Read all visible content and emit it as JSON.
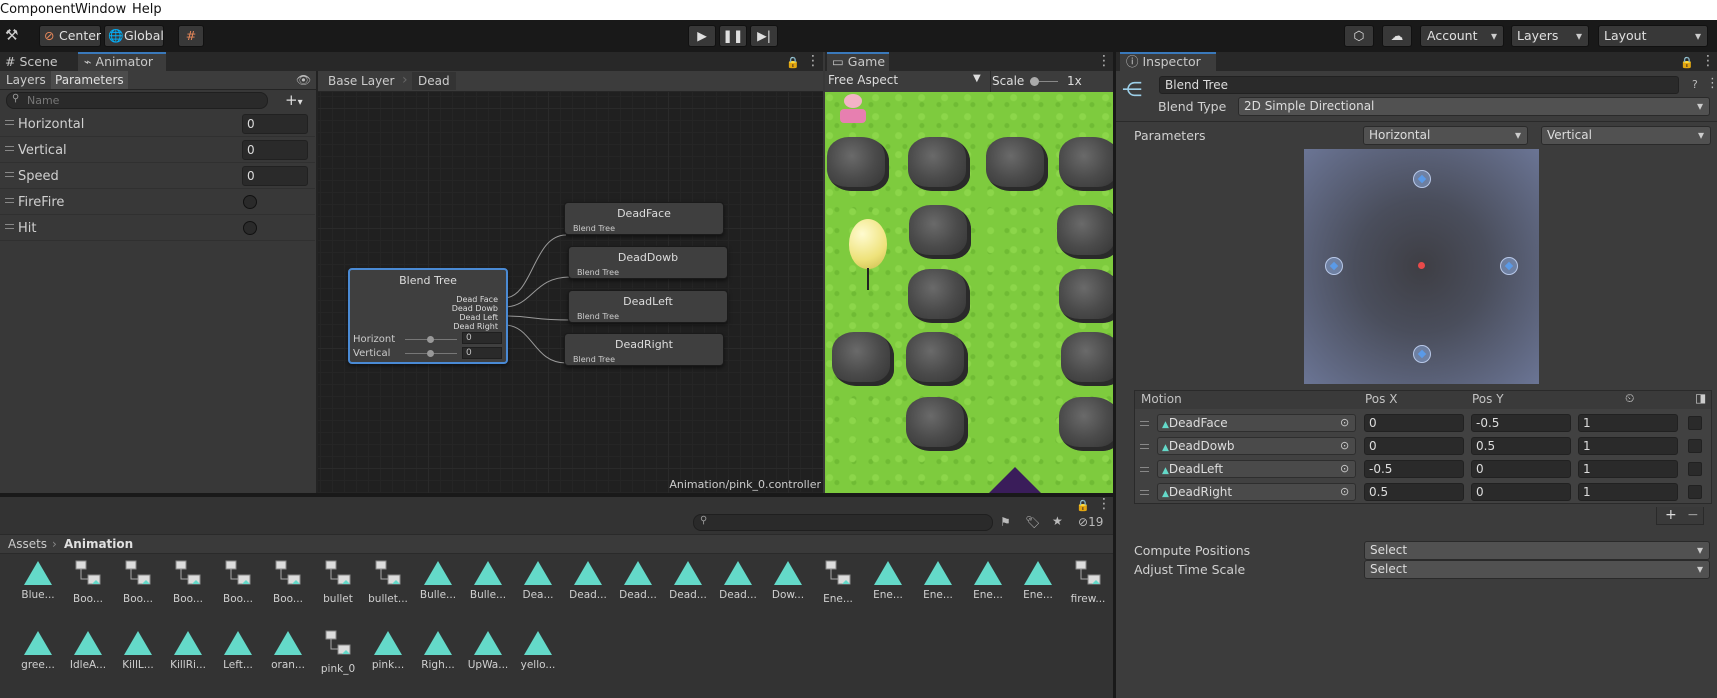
{
  "menubar": {
    "items": [
      "Component",
      "Window",
      "Help"
    ]
  },
  "toolbar": {
    "center_label": "Center",
    "global_label": "Global",
    "account_label": "Account",
    "layers_label": "Layers",
    "layout_label": "Layout"
  },
  "left_panel": {
    "tabs": [
      "Scene",
      "Animator"
    ],
    "subtabs": [
      "Layers",
      "Parameters"
    ],
    "search_placeholder": "Name",
    "parameters": [
      {
        "name": "Horizontal",
        "type": "float",
        "value": "0"
      },
      {
        "name": "Vertical",
        "type": "float",
        "value": "0"
      },
      {
        "name": "Speed",
        "type": "float",
        "value": "0"
      },
      {
        "name": "FireFire",
        "type": "trigger",
        "value": ""
      },
      {
        "name": "Hit",
        "type": "trigger",
        "value": ""
      }
    ]
  },
  "graph": {
    "breadcrumb": [
      "Base Layer",
      "Dead"
    ],
    "footer_path": "Animation/pink_0.controller",
    "blend_node": {
      "title": "Blend Tree",
      "outputs": [
        "Dead Face",
        "Dead Dowb",
        "Dead Left",
        "Dead Right"
      ],
      "params": [
        {
          "name": "Horizont",
          "value": "0"
        },
        {
          "name": "Vertical",
          "value": "0"
        }
      ]
    },
    "clips": [
      {
        "title": "DeadFace",
        "sub": "Blend Tree"
      },
      {
        "title": "DeadDowb",
        "sub": "Blend Tree"
      },
      {
        "title": "DeadLeft",
        "sub": "Blend Tree"
      },
      {
        "title": "DeadRight",
        "sub": "Blend Tree"
      }
    ]
  },
  "game": {
    "tab": "Game",
    "aspect": "Free Aspect",
    "scale_label": "Scale",
    "scale_value": "1x"
  },
  "inspector": {
    "tab": "Inspector",
    "name": "Blend Tree",
    "blend_type_label": "Blend Type",
    "blend_type": "2D Simple Directional",
    "parameters_label": "Parameters",
    "param_x": "Horizontal",
    "param_y": "Vertical",
    "motion_headers": [
      "Motion",
      "Pos X",
      "Pos Y"
    ],
    "motions": [
      {
        "name": "DeadFace",
        "x": "0",
        "y": "-0.5",
        "speed": "1"
      },
      {
        "name": "DeadDowb",
        "x": "0",
        "y": "0.5",
        "speed": "1"
      },
      {
        "name": "DeadLeft",
        "x": "-0.5",
        "y": "0",
        "speed": "1"
      },
      {
        "name": "DeadRight",
        "x": "0.5",
        "y": "0",
        "speed": "1"
      }
    ],
    "compute_label": "Compute Positions",
    "compute_value": "Select",
    "adjust_label": "Adjust Time Scale",
    "adjust_value": "Select"
  },
  "project": {
    "breadcrumb": [
      "Assets",
      "Animation"
    ],
    "hidden_count": "19",
    "assets": [
      {
        "label": "Blue...",
        "icon": "clip"
      },
      {
        "label": "Boo...",
        "icon": "tree"
      },
      {
        "label": "Boo...",
        "icon": "tree"
      },
      {
        "label": "Boo...",
        "icon": "tree"
      },
      {
        "label": "Boo...",
        "icon": "tree"
      },
      {
        "label": "Boo...",
        "icon": "tree"
      },
      {
        "label": "bullet",
        "icon": "tree"
      },
      {
        "label": "bullet...",
        "icon": "tree"
      },
      {
        "label": "Bulle...",
        "icon": "clip"
      },
      {
        "label": "Bulle...",
        "icon": "clip"
      },
      {
        "label": "Dea...",
        "icon": "clip"
      },
      {
        "label": "Dead...",
        "icon": "clip"
      },
      {
        "label": "Dead...",
        "icon": "clip"
      },
      {
        "label": "Dead...",
        "icon": "clip"
      },
      {
        "label": "Dead...",
        "icon": "clip"
      },
      {
        "label": "Dow...",
        "icon": "clip"
      },
      {
        "label": "Ene...",
        "icon": "tree"
      },
      {
        "label": "Ene...",
        "icon": "clip"
      },
      {
        "label": "Ene...",
        "icon": "clip"
      },
      {
        "label": "Ene...",
        "icon": "clip"
      },
      {
        "label": "Ene...",
        "icon": "clip"
      },
      {
        "label": "firew...",
        "icon": "tree"
      },
      {
        "label": "gree...",
        "icon": "clip"
      },
      {
        "label": "IdleA...",
        "icon": "clip"
      },
      {
        "label": "KillL...",
        "icon": "clip"
      },
      {
        "label": "KillRi...",
        "icon": "clip"
      },
      {
        "label": "Left...",
        "icon": "clip"
      },
      {
        "label": "oran...",
        "icon": "clip"
      },
      {
        "label": "pink_0",
        "icon": "tree"
      },
      {
        "label": "pink...",
        "icon": "clip"
      },
      {
        "label": "Righ...",
        "icon": "clip"
      },
      {
        "label": "UpWa...",
        "icon": "clip"
      },
      {
        "label": "yello...",
        "icon": "clip"
      }
    ]
  },
  "colors": {
    "accent": "#3a79bb",
    "clip_icon": "#64d9c9",
    "grass": "#7ecb3e"
  }
}
